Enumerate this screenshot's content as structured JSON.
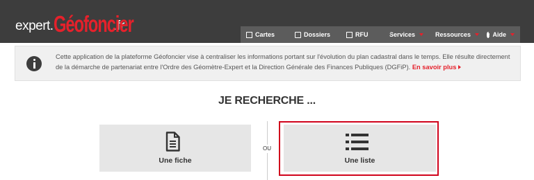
{
  "header": {
    "logo": {
      "prefix": "expert.",
      "brand": "Géofoncier",
      "suffix": ".fr"
    },
    "nav": [
      {
        "label": "Cartes",
        "icon": "map-icon",
        "caret": false
      },
      {
        "label": "Dossiers",
        "icon": "folder-icon",
        "caret": false
      },
      {
        "label": "RFU",
        "icon": "rfu-icon",
        "caret": false
      },
      {
        "label": "Services",
        "icon": "plus-circle-icon",
        "caret": true
      },
      {
        "label": "Ressources",
        "icon": "book-icon",
        "caret": true
      },
      {
        "label": "Aide",
        "icon": "help-icon",
        "caret": true
      }
    ]
  },
  "info": {
    "text": "Cette application de la plateforme Géofoncier vise à centraliser les informations portant sur l'évolution du plan cadastral dans le temps. Elle résulte directement de la démarche de partenariat entre l'Ordre des Géomètre-Expert et la Direction Générale des Finances Publiques (DGFiP).",
    "link": "En savoir plus"
  },
  "main": {
    "title": "JE RECHERCHE ...",
    "separator": "OU",
    "options": [
      {
        "label": "Une fiche",
        "icon": "document-icon"
      },
      {
        "label": "Une liste",
        "icon": "list-icon"
      }
    ]
  },
  "colors": {
    "header": "#3d3d3d",
    "nav": "#5c5c5c",
    "accent": "#e5212b",
    "highlight": "#d0021b",
    "card": "#e6e6e6"
  }
}
